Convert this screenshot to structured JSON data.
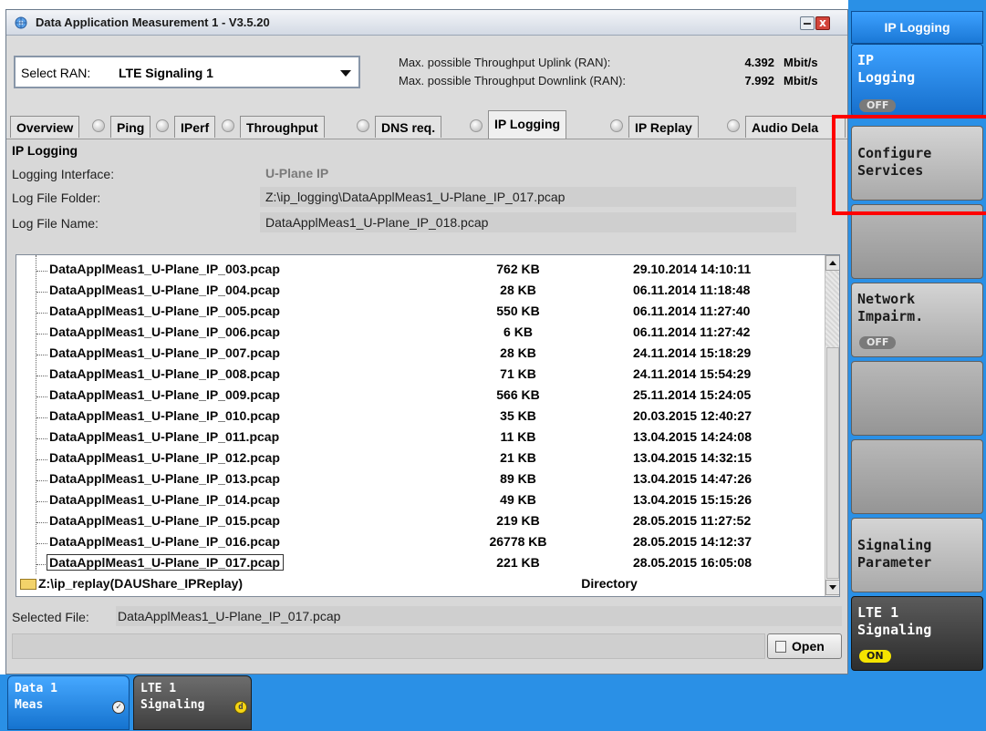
{
  "window": {
    "title": "Data Application Measurement 1 - V3.5.20",
    "close_glyph": "x"
  },
  "ran": {
    "label": "Select RAN:",
    "value": "LTE Signaling 1"
  },
  "throughput": {
    "uplink_label": "Max. possible Throughput Uplink (RAN):",
    "uplink_value": "4.392",
    "downlink_label": "Max. possible Throughput Downlink (RAN):",
    "downlink_value": "7.992",
    "unit": "Mbit/s"
  },
  "tabs": [
    {
      "label": "Overview"
    },
    {
      "label": "Ping"
    },
    {
      "label": "IPerf"
    },
    {
      "label": "Throughput"
    },
    {
      "label": "DNS req."
    },
    {
      "label": "IP Logging"
    },
    {
      "label": "IP Replay"
    },
    {
      "label": "Audio Dela"
    }
  ],
  "active_tab": "IP Logging",
  "section": {
    "title": "IP Logging",
    "logging_interface_label": "Logging Interface:",
    "logging_interface_value": "U-Plane IP",
    "log_file_folder_label": "Log File Folder:",
    "log_file_folder_value": "Z:\\ip_logging\\DataApplMeas1_U-Plane_IP_017.pcap",
    "log_file_name_label": "Log File Name:",
    "log_file_name_value": "DataApplMeas1_U-Plane_IP_018.pcap"
  },
  "files": [
    {
      "name": "DataApplMeas1_U-Plane_IP_003.pcap",
      "size": "762 KB",
      "date": "29.10.2014 14:10:11"
    },
    {
      "name": "DataApplMeas1_U-Plane_IP_004.pcap",
      "size": "28 KB",
      "date": "06.11.2014 11:18:48"
    },
    {
      "name": "DataApplMeas1_U-Plane_IP_005.pcap",
      "size": "550 KB",
      "date": "06.11.2014 11:27:40"
    },
    {
      "name": "DataApplMeas1_U-Plane_IP_006.pcap",
      "size": "6 KB",
      "date": "06.11.2014 11:27:42"
    },
    {
      "name": "DataApplMeas1_U-Plane_IP_007.pcap",
      "size": "28 KB",
      "date": "24.11.2014 15:18:29"
    },
    {
      "name": "DataApplMeas1_U-Plane_IP_008.pcap",
      "size": "71 KB",
      "date": "24.11.2014 15:54:29"
    },
    {
      "name": "DataApplMeas1_U-Plane_IP_009.pcap",
      "size": "566 KB",
      "date": "25.11.2014 15:24:05"
    },
    {
      "name": "DataApplMeas1_U-Plane_IP_010.pcap",
      "size": "35 KB",
      "date": "20.03.2015 12:40:27"
    },
    {
      "name": "DataApplMeas1_U-Plane_IP_011.pcap",
      "size": "11 KB",
      "date": "13.04.2015 14:24:08"
    },
    {
      "name": "DataApplMeas1_U-Plane_IP_012.pcap",
      "size": "21 KB",
      "date": "13.04.2015 14:32:15"
    },
    {
      "name": "DataApplMeas1_U-Plane_IP_013.pcap",
      "size": "89 KB",
      "date": "13.04.2015 14:47:26"
    },
    {
      "name": "DataApplMeas1_U-Plane_IP_014.pcap",
      "size": "49 KB",
      "date": "13.04.2015 15:15:26"
    },
    {
      "name": "DataApplMeas1_U-Plane_IP_015.pcap",
      "size": "219 KB",
      "date": "28.05.2015 11:27:52"
    },
    {
      "name": "DataApplMeas1_U-Plane_IP_016.pcap",
      "size": "26778 KB",
      "date": "28.05.2015 14:12:37"
    },
    {
      "name": "DataApplMeas1_U-Plane_IP_017.pcap",
      "size": "221 KB",
      "date": "28.05.2015 16:05:08"
    }
  ],
  "selected_file_index": 14,
  "directory_row": {
    "name": "Z:\\ip_replay(DAUShare_IPReplay)",
    "size": "Directory"
  },
  "selected_file": {
    "label": "Selected File:",
    "value": "DataApplMeas1_U-Plane_IP_017.pcap"
  },
  "open_button": {
    "label": "Open"
  },
  "softkeys": {
    "header": "IP Logging",
    "ip_logging": {
      "label": "IP\nLogging",
      "state": "OFF"
    },
    "configure_services": {
      "label": "Configure\nServices"
    },
    "network_impairm": {
      "label": "Network\nImpairm.",
      "state": "OFF"
    },
    "signaling_parameter": {
      "label": "Signaling\nParameter"
    },
    "lte1_signaling": {
      "label": "LTE 1\nSignaling",
      "state": "ON"
    }
  },
  "taskbar": {
    "data_meas_line1": "Data 1",
    "data_meas_line2": "Meas",
    "data_meas_icon": "✓",
    "lte_line1": "LTE 1",
    "lte_line2": "Signaling",
    "lte_icon": "d"
  },
  "colors": {
    "accent_blue": "#2a90e6",
    "highlight_red": "#ff0000",
    "state_on": "#f5e400",
    "state_off": "#7a7a7a"
  }
}
